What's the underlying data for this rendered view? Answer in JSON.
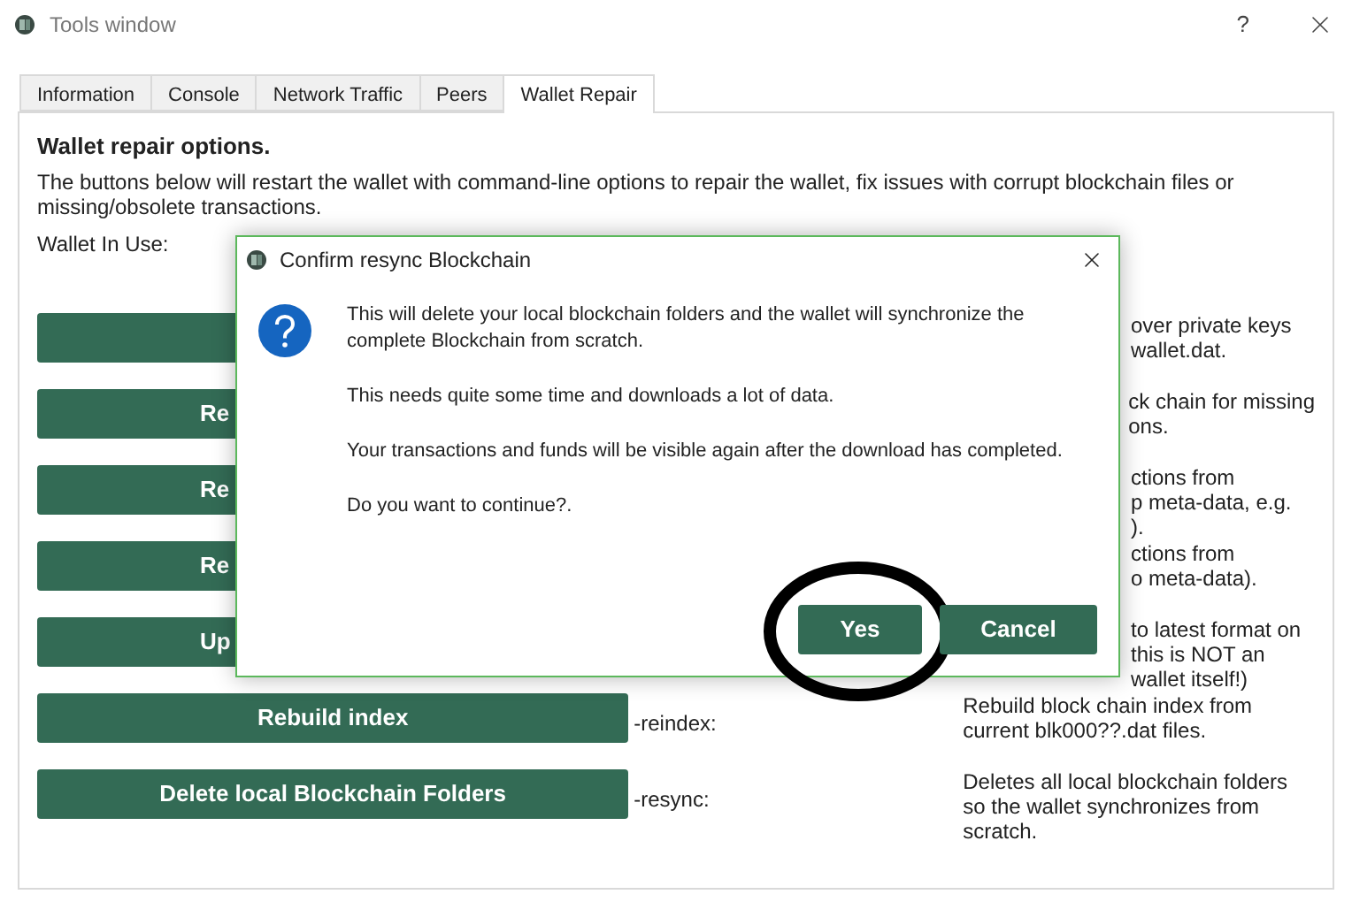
{
  "window": {
    "title": "Tools window",
    "help": "?"
  },
  "tabs": [
    {
      "label": "Information",
      "selected": false
    },
    {
      "label": "Console",
      "selected": false
    },
    {
      "label": "Network Traffic",
      "selected": false
    },
    {
      "label": "Peers",
      "selected": false
    },
    {
      "label": "Wallet Repair",
      "selected": true
    }
  ],
  "panel": {
    "heading": "Wallet repair options.",
    "description": "The buttons below will restart the wallet with command-line options to repair the wallet, fix issues with corrupt blockchain files or missing/obsolete transactions.",
    "wallet_label": "Wallet In Use:"
  },
  "rows": [
    {
      "kind": "covered",
      "description": "over private keys\nwallet.dat."
    },
    {
      "kind": "covered",
      "button": "Re",
      "description": "ck chain for missing\nons."
    },
    {
      "kind": "covered",
      "button": "Re",
      "description": "ctions from\np meta-data, e.g.\n)."
    },
    {
      "kind": "covered",
      "button": "Re",
      "description": "ctions from\no meta-data)."
    },
    {
      "kind": "covered",
      "button": "Up",
      "description": "to latest format on\nthis is NOT an\nwallet itself!)"
    },
    {
      "kind": "full",
      "button": "Rebuild index",
      "option": "-reindex:",
      "description": "Rebuild block chain index from current blk000??.dat files."
    },
    {
      "kind": "full",
      "button": "Delete local Blockchain Folders",
      "option": "-resync:",
      "description": "Deletes all local blockchain folders so the wallet synchronizes from scratch."
    }
  ],
  "dialog": {
    "title": "Confirm resync Blockchain",
    "paragraphs": [
      "This will delete your local blockchain folders and the wallet will synchronize the complete Blockchain from scratch.",
      "This needs quite some time and downloads a lot of data.",
      "Your transactions and funds will be visible again after the download has completed.",
      "Do you want to continue?."
    ],
    "buttons": [
      {
        "label": "Yes",
        "highlighted": true
      },
      {
        "label": "Cancel",
        "highlighted": false
      }
    ]
  }
}
